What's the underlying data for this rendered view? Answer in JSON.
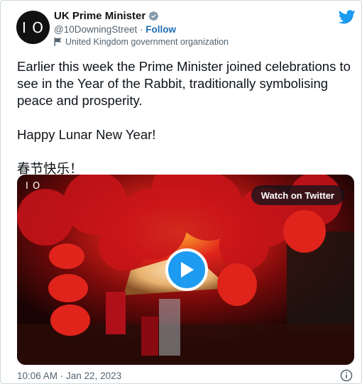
{
  "author": {
    "avatar_text": "I O",
    "display_name": "UK Prime Minister",
    "handle": "@10DowningStreet",
    "separator": " · ",
    "follow_label": "Follow",
    "affiliation": "United Kingdom government organization"
  },
  "tweet": {
    "paragraphs": [
      "Earlier this week the Prime Minister joined celebrations to see in the Year of the Rabbit, traditionally symbolising peace and prosperity.",
      "Happy Lunar New Year!",
      "春节快乐！"
    ],
    "timestamp": "10:06 AM · Jan 22, 2023"
  },
  "media": {
    "logo_text": "I O",
    "watch_label": "Watch on Twitter"
  },
  "colors": {
    "accent": "#1d9bf0",
    "follow_link": "#1d6fb8",
    "secondary_text": "#536471",
    "verified_badge": "#829aab"
  },
  "icons": {
    "verified": "verified-badge-icon",
    "affiliation": "flag-icon",
    "brand": "twitter-bird-icon",
    "play": "play-icon",
    "info": "info-icon"
  }
}
